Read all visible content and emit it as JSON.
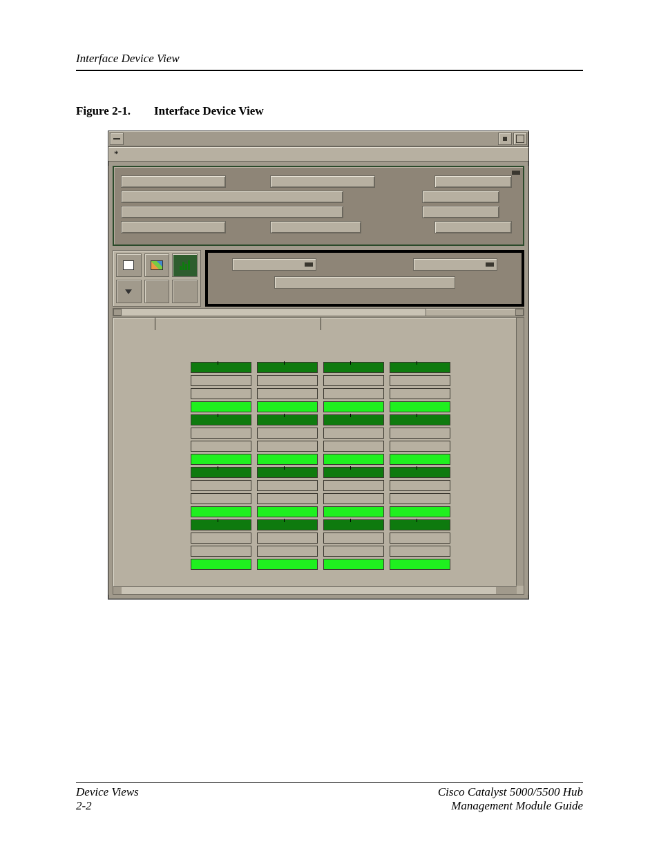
{
  "header": {
    "running": "Interface Device View"
  },
  "figure": {
    "label": "Figure 2-1.",
    "title": "Interface Device View"
  },
  "window": {
    "menu_star": "*"
  },
  "grid": {
    "columns": 4,
    "rows": [
      {
        "type": "dk",
        "tick": true
      },
      {
        "type": "gy"
      },
      {
        "type": "gy"
      },
      {
        "type": "br"
      },
      {
        "type": "dk",
        "tick": true
      },
      {
        "type": "gy"
      },
      {
        "type": "gy"
      },
      {
        "type": "br"
      },
      {
        "type": "dk",
        "tick": true
      },
      {
        "type": "gy"
      },
      {
        "type": "gy"
      },
      {
        "type": "br"
      },
      {
        "type": "dk",
        "tick": true
      },
      {
        "type": "gy"
      },
      {
        "type": "gy"
      },
      {
        "type": "br"
      }
    ]
  },
  "footer": {
    "left1": "Device Views",
    "left2": "2-2",
    "right1": "Cisco Catalyst 5000/5500 Hub",
    "right2": "Management Module Guide"
  }
}
